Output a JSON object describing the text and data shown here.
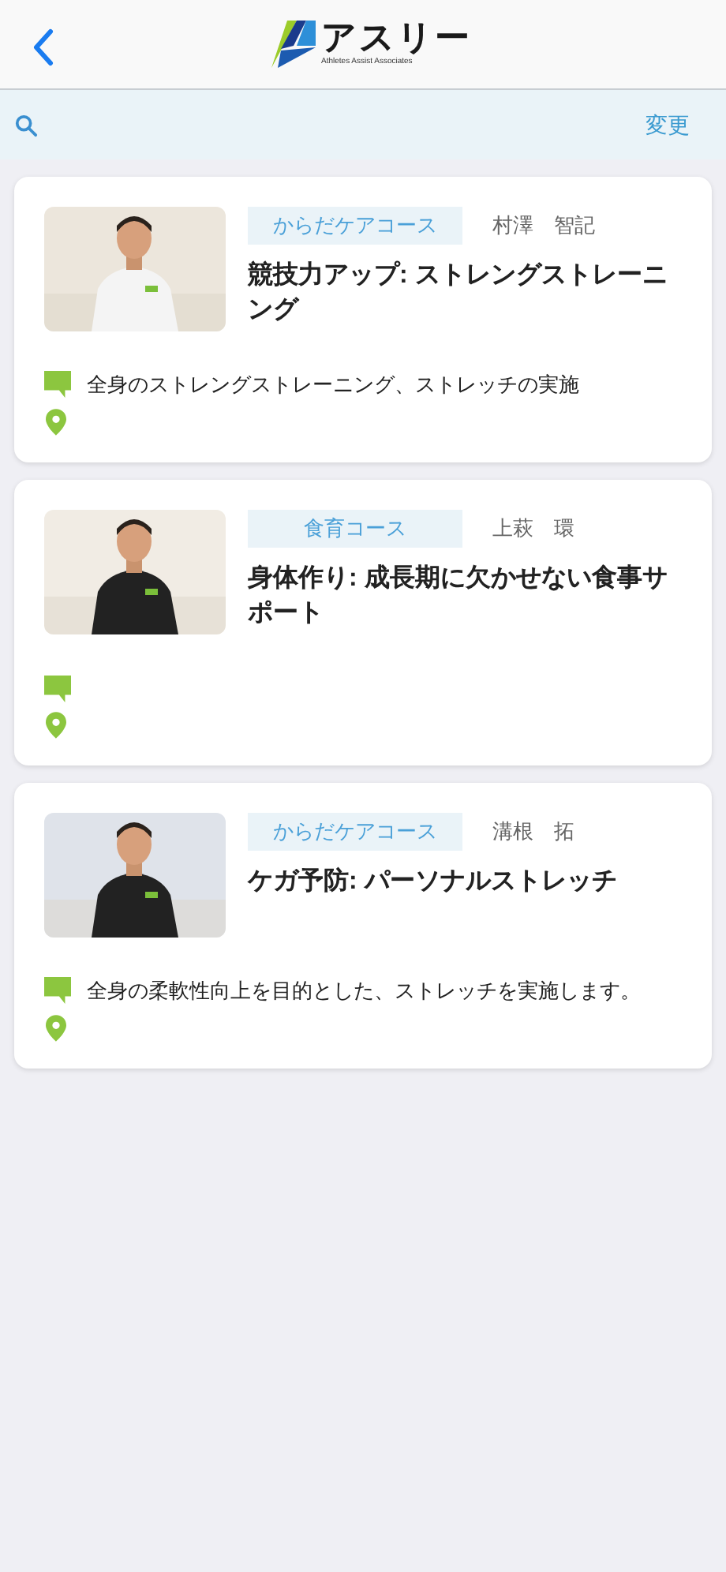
{
  "header": {
    "logo_text": "アスリー",
    "logo_subtitle": "Athletes Assist Associates"
  },
  "search_bar": {
    "action": "変更"
  },
  "courses": [
    {
      "tag": "からだケアコース",
      "trainer": "村澤　智記",
      "title": "競技力アップ: ストレングストレーニング",
      "description": "全身のストレングストレーニング、ストレッチの実施"
    },
    {
      "tag": "食育コース",
      "trainer": "上萩　環",
      "title": "身体作り: 成長期に欠かせない食事サポート"
    },
    {
      "tag": "からだケアコース",
      "trainer": "溝根　拓",
      "title": "ケガ予防: パーソナルストレッチ",
      "description": "全身の柔軟性向上を目的とした、ストレッチを実施します。"
    }
  ]
}
